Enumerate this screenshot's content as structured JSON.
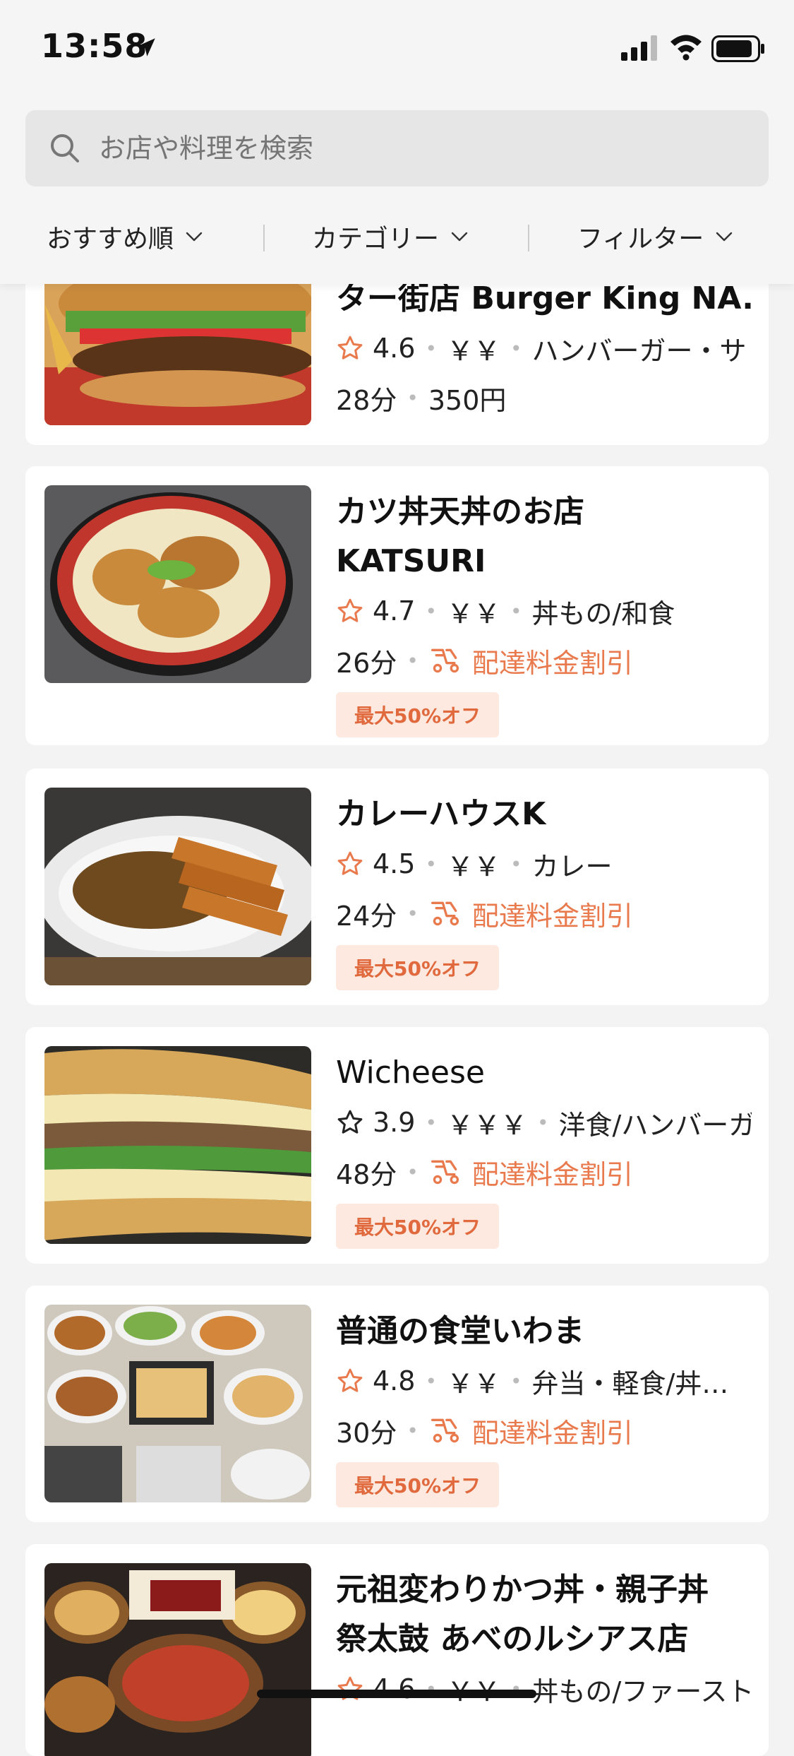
{
  "status_bar": {
    "time": "13:58"
  },
  "search": {
    "placeholder": "お店や料理を検索"
  },
  "filters": [
    {
      "label": "おすすめ順"
    },
    {
      "label": "カテゴリー"
    },
    {
      "label": "フィルター"
    }
  ],
  "restaurants": [
    {
      "name_line1": "ター街店 Burger King NA...",
      "rating": "4.6",
      "price": "￥￥",
      "category": "ハンバーガー・サ",
      "time": "28分",
      "fee": "350円"
    },
    {
      "name_line1": "カツ丼天丼のお店",
      "name_line2": "KATSURI",
      "rating": "4.7",
      "price": "￥￥",
      "category": "丼もの/和食",
      "time": "26分",
      "deal": "配達料金割引",
      "badge": "最大50%オフ"
    },
    {
      "name_line1": "カレーハウスK",
      "rating": "4.5",
      "price": "￥￥",
      "category": "カレー",
      "time": "24分",
      "deal": "配達料金割引",
      "badge": "最大50%オフ"
    },
    {
      "name_line1": "Wicheese",
      "rating": "3.9",
      "price": "￥￥￥",
      "category": "洋食/ハンバーガ",
      "time": "48分",
      "deal": "配達料金割引",
      "badge": "最大50%オフ"
    },
    {
      "name_line1": "普通の食堂いわま",
      "rating": "4.8",
      "price": "￥￥",
      "category": "弁当・軽食/丼…",
      "time": "30分",
      "deal": "配達料金割引",
      "badge": "最大50%オフ"
    },
    {
      "name_line1": "元祖変わりかつ丼・親子丼",
      "name_line2": "祭太鼓 あべのルシアス店",
      "rating": "4.6",
      "price": "￥￥",
      "category": "丼もの/ファースト"
    }
  ],
  "colors": {
    "accent": "#e97a4e",
    "badge_bg": "#fde9df"
  }
}
